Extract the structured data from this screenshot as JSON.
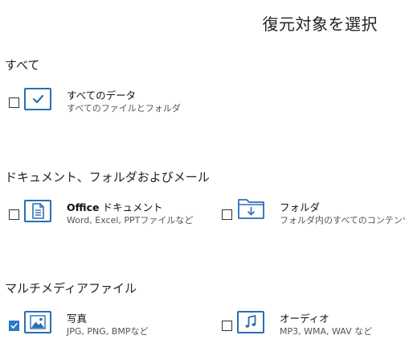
{
  "header": {
    "title": "復元対象を選択"
  },
  "sections": [
    {
      "title": "すべて",
      "options": [
        {
          "title": "すべてのデータ",
          "subtitle": "すべてのファイルとフォルダ",
          "checked": false,
          "icon": "check-box-icon"
        }
      ]
    },
    {
      "title": "ドキュメント、フォルダおよびメール",
      "options": [
        {
          "title_bold": "Office",
          "title": "ドキュメント",
          "subtitle": "Word, Excel, PPTファイルなど",
          "checked": false,
          "icon": "document-icon"
        },
        {
          "title": "フォルダ",
          "subtitle": "フォルダ内のすべてのコンテンツ",
          "checked": false,
          "icon": "folder-download-icon"
        }
      ]
    },
    {
      "title": "マルチメディアファイル",
      "options": [
        {
          "title": "写真",
          "subtitle": "JPG, PNG, BMPなど",
          "checked": true,
          "icon": "image-icon"
        },
        {
          "title": "オーディオ",
          "subtitle": "MP3, WMA, WAV など",
          "checked": false,
          "icon": "music-note-icon"
        }
      ]
    }
  ],
  "colors": {
    "accent": "#2a6fb5",
    "checkbox_checked": "#2a78c8",
    "text": "#1a1a1a",
    "subtext": "#555555"
  }
}
